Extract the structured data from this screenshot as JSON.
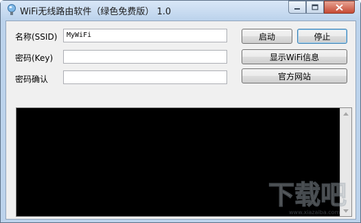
{
  "window": {
    "title": "WiFi无线路由软件（绿色免费版） 1.0"
  },
  "form": {
    "ssid_label": "名称(SSID)",
    "ssid_value": "MyWiFi",
    "key_label": "密码(Key)",
    "key_value": "",
    "confirm_label": "密码确认",
    "confirm_value": ""
  },
  "buttons": {
    "start": "启动",
    "stop": "停止",
    "show_info": "显示WiFi信息",
    "website": "官方网站"
  },
  "colors": {
    "console_bg": "#000000",
    "frame": "#bcd3ec",
    "close_button": "#c64a35"
  },
  "icons": [
    "app-bulb-icon",
    "minimize-icon",
    "maximize-icon",
    "close-icon",
    "scroll-up-icon",
    "scroll-down-icon"
  ],
  "watermark": {
    "text": "下载吧",
    "url": "www.xiazaiba.com"
  }
}
